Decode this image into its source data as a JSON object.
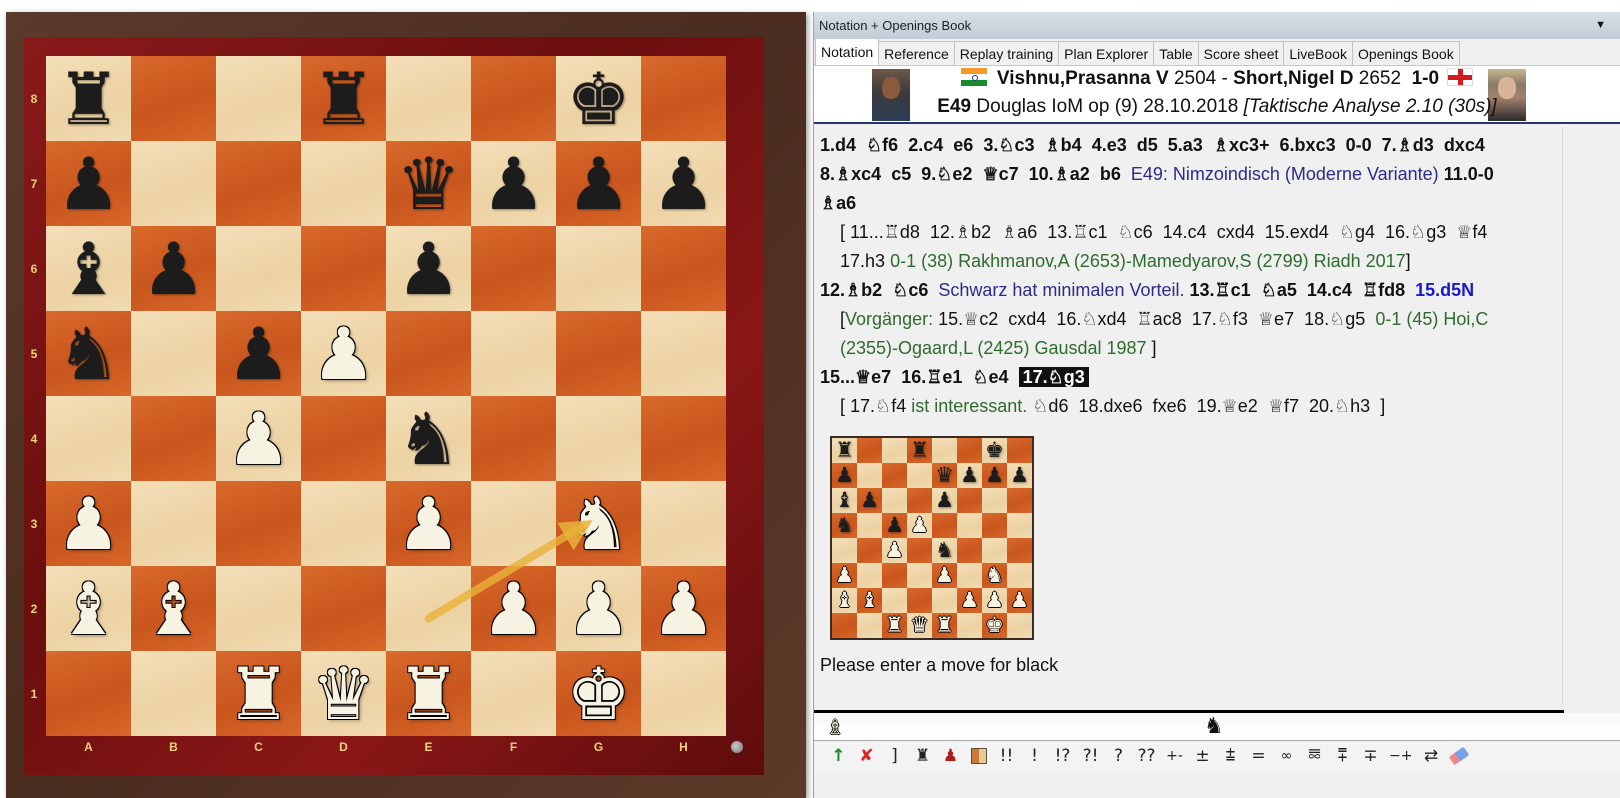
{
  "board": {
    "ranks": [
      "8",
      "7",
      "6",
      "5",
      "4",
      "3",
      "2",
      "1"
    ],
    "files": [
      "A",
      "B",
      "C",
      "D",
      "E",
      "F",
      "G",
      "H"
    ],
    "position": [
      [
        "bR",
        "",
        "",
        "bR",
        "",
        "",
        "bK",
        ""
      ],
      [
        "bP",
        "",
        "",
        "",
        "bQ",
        "bP",
        "bP",
        "bP"
      ],
      [
        "bB",
        "bP",
        "",
        "",
        "bP",
        "",
        "",
        ""
      ],
      [
        "bN",
        "",
        "bP",
        "wP",
        "",
        "",
        "",
        ""
      ],
      [
        "",
        "",
        "wP",
        "",
        "bN",
        "",
        "",
        ""
      ],
      [
        "wP",
        "",
        "",
        "",
        "wP",
        "",
        "wN",
        ""
      ],
      [
        "wB",
        "wB",
        "",
        "",
        "",
        "wP",
        "wP",
        "wP"
      ],
      [
        "",
        "",
        "wR",
        "wQ",
        "wR",
        "",
        "wK",
        ""
      ]
    ],
    "last_move": {
      "from": "e2",
      "to": "g3",
      "arrow_color": "#e8b23a"
    },
    "side_to_move": "black"
  },
  "panel": {
    "title": "Notation + Openings Book",
    "dropdown_icon": "▼",
    "tabs": [
      {
        "label": "Notation",
        "active": true
      },
      {
        "label": "Reference",
        "active": false
      },
      {
        "label": "Replay training",
        "active": false
      },
      {
        "label": "Plan Explorer",
        "active": false
      },
      {
        "label": "Table",
        "active": false
      },
      {
        "label": "Score sheet",
        "active": false
      },
      {
        "label": "LiveBook",
        "active": false
      },
      {
        "label": "Openings Book",
        "active": false
      }
    ]
  },
  "game_header": {
    "white_name": "Vishnu,Prasanna V",
    "white_elo": "2504",
    "separator": " - ",
    "black_name": "Short,Nigel D",
    "black_elo": "2652",
    "result": "1-0",
    "eco": "E49",
    "event": "Douglas IoM op (9) 28.10.2018",
    "annotator": "[Taktische Analyse 2.10 (30s)]",
    "white_flag": "India",
    "black_flag": "England"
  },
  "notation": {
    "line1": [
      "1.d4",
      "♘f6",
      "2.c4",
      "e6",
      "3.♘c3",
      "♗b4",
      "4.e3",
      "d5",
      "5.a3",
      "♗xc3+",
      "6.bxc3",
      "0-0",
      "7.♗d3",
      "dxc4"
    ],
    "line2": [
      "8.♗xc4",
      "c5",
      "9.♘e2",
      "♕c7",
      "10.♗a2",
      "b6"
    ],
    "line2_comment": "E49: Nimzoindisch (Moderne Variante)",
    "line2_tail": "11.0-0",
    "line3": "♗a6",
    "var1_open": "[",
    "var1_moves": [
      "11...♖d8",
      "12.♗b2",
      "♗a6",
      "13.♖c1",
      "♘c6",
      "14.c4",
      "cxd4",
      "15.exd4",
      "♘g4",
      "16.♘g3",
      "♕f4"
    ],
    "var1_line2_move": "17.h3",
    "var1_reference": "0-1 (38) Rakhmanov,A (2653)-Mamedyarov,S (2799) Riadh 2017",
    "var1_close": "]",
    "line4_moves_a": [
      "12.♗b2",
      "♘c6"
    ],
    "line4_comment": "Schwarz hat minimalen Vorteil.",
    "line4_moves_b": [
      "13.♖c1",
      "♘a5",
      "14.c4",
      "♖fd8"
    ],
    "line4_novelty": "15.d5N",
    "var2_open": "[",
    "var2_label": "Vorgänger:",
    "var2_moves": [
      "15.♕c2",
      "cxd4",
      "16.♘xd4",
      "♖ac8",
      "17.♘f3",
      "♕e7",
      "18.♘g5"
    ],
    "var2_reference_a": "0-1 (45) Hoi,C",
    "var2_reference_b": "(2355)-Ogaard,L (2425) Gausdal 1987",
    "var2_close": "]",
    "line5_moves": [
      "15...♕e7",
      "16.♖e1",
      "♘e4"
    ],
    "current_move": "17.♘g3",
    "var3_open": "[",
    "var3_move": "17.♘f4",
    "var3_comment": "ist interessant.",
    "var3_moves": [
      "♘d6",
      "18.dxe6",
      "fxe6",
      "19.♕e2",
      "♕f7",
      "20.♘h3"
    ],
    "var3_close": "]"
  },
  "prompt": "Please enter a move for black",
  "side_indicator": {
    "white_icon": "♗",
    "black_icon": "♞"
  },
  "toolbar": [
    {
      "name": "promote-variation-button",
      "label": "↑"
    },
    {
      "name": "delete-button",
      "label": "✘"
    },
    {
      "name": "variation-end-button",
      "label": "]"
    },
    {
      "name": "black-piece-button",
      "label": "♜"
    },
    {
      "name": "red-piece-button",
      "label": "♟"
    },
    {
      "name": "board-diagram-button",
      "label": ""
    },
    {
      "name": "brilliant-move-button",
      "label": "!!"
    },
    {
      "name": "good-move-button",
      "label": "!"
    },
    {
      "name": "interesting-move-button",
      "label": "!?"
    },
    {
      "name": "dubious-move-button",
      "label": "?!"
    },
    {
      "name": "mistake-button",
      "label": "?"
    },
    {
      "name": "blunder-button",
      "label": "??"
    },
    {
      "name": "white-winning-button",
      "label": "+-"
    },
    {
      "name": "white-better-button",
      "label": "±"
    },
    {
      "name": "white-slightly-better-button",
      "label": "⩲"
    },
    {
      "name": "equal-button",
      "label": "="
    },
    {
      "name": "unclear-button",
      "label": "∞"
    },
    {
      "name": "compensation-button",
      "label": "⯹"
    },
    {
      "name": "black-slightly-better-button",
      "label": "⩱"
    },
    {
      "name": "black-better-button",
      "label": "∓"
    },
    {
      "name": "black-winning-button",
      "label": "−+"
    },
    {
      "name": "counterplay-button",
      "label": "⇄"
    },
    {
      "name": "eraser-button",
      "label": ""
    }
  ]
}
